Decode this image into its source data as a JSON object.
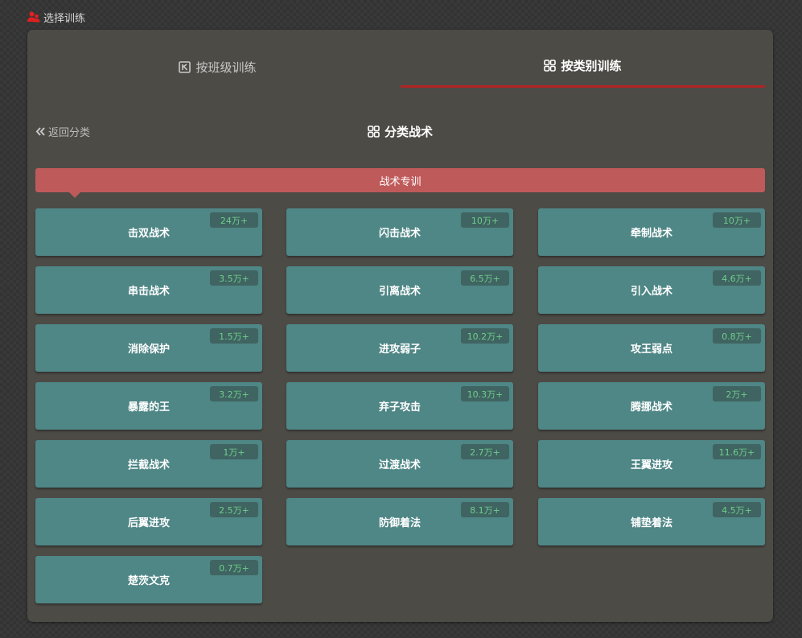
{
  "header": {
    "title": "选择训练"
  },
  "tabs": [
    {
      "label": "按班级训练",
      "active": false
    },
    {
      "label": "按类别训练",
      "active": true
    }
  ],
  "nav": {
    "back_label": "返回分类",
    "section_title": "分类战术"
  },
  "category": {
    "label": "战术专训"
  },
  "colors": {
    "accent": "#b22424",
    "category_bar": "#bf5a5a",
    "card": "#4f8686",
    "badge_bg": "#3f6461",
    "badge_text": "#6fcd8d"
  },
  "cards": [
    {
      "name": "击双战术",
      "count": "24万+"
    },
    {
      "name": "闪击战术",
      "count": "10万+"
    },
    {
      "name": "牵制战术",
      "count": "10万+"
    },
    {
      "name": "串击战术",
      "count": "3.5万+"
    },
    {
      "name": "引离战术",
      "count": "6.5万+"
    },
    {
      "name": "引入战术",
      "count": "4.6万+"
    },
    {
      "name": "消除保护",
      "count": "1.5万+"
    },
    {
      "name": "进攻弱子",
      "count": "10.2万+"
    },
    {
      "name": "攻王弱点",
      "count": "0.8万+"
    },
    {
      "name": "暴露的王",
      "count": "3.2万+"
    },
    {
      "name": "弃子攻击",
      "count": "10.3万+"
    },
    {
      "name": "腾挪战术",
      "count": "2万+"
    },
    {
      "name": "拦截战术",
      "count": "1万+"
    },
    {
      "name": "过渡战术",
      "count": "2.7万+"
    },
    {
      "name": "王翼进攻",
      "count": "11.6万+"
    },
    {
      "name": "后翼进攻",
      "count": "2.5万+"
    },
    {
      "name": "防御着法",
      "count": "8.1万+"
    },
    {
      "name": "铺垫着法",
      "count": "4.5万+"
    },
    {
      "name": "楚茨文克",
      "count": "0.7万+"
    }
  ]
}
